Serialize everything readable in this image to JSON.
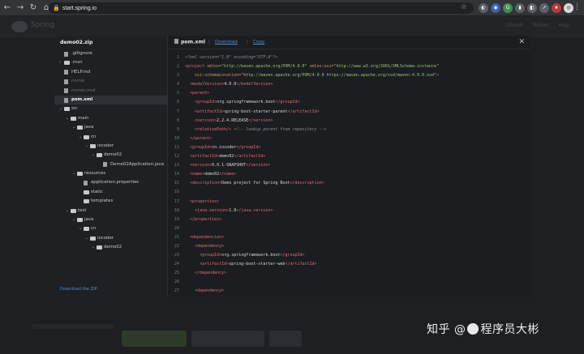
{
  "browser": {
    "url": "start.spring.io",
    "nav": {
      "back": "←",
      "forward": "→",
      "reload": "↻",
      "home": "⌂"
    },
    "lock": "🔒",
    "star": "☆",
    "extensions": [
      "◐",
      "◉",
      "G",
      "▮",
      "◧",
      "↗",
      "★",
      "◎"
    ],
    "menu": "⋮"
  },
  "background_page": {
    "title": "Spring",
    "header_links": [
      "GitHub",
      "Twitter",
      "Help"
    ]
  },
  "modal": {
    "archive_name": "demo02.zip",
    "download_zip_label": "Download the ZIP",
    "close_label": "✕",
    "tree": [
      {
        "label": ".gitignore",
        "depth": 0,
        "type": "file",
        "dim": false
      },
      {
        "label": ".mvn",
        "depth": 0,
        "type": "folder",
        "expand": "›",
        "dim": false
      },
      {
        "label": "HELP.md",
        "depth": 0,
        "type": "file",
        "dim": false
      },
      {
        "label": "mvnw",
        "depth": 0,
        "type": "file",
        "dim": true
      },
      {
        "label": "mvnw.cmd",
        "depth": 0,
        "type": "file",
        "dim": true
      },
      {
        "label": "pom.xml",
        "depth": 0,
        "type": "file",
        "selected": true
      },
      {
        "label": "src",
        "depth": 0,
        "type": "folder",
        "expand": "⌄"
      },
      {
        "label": "main",
        "depth": 1,
        "type": "folder",
        "expand": "⌄"
      },
      {
        "label": "java",
        "depth": 2,
        "type": "folder",
        "expand": "⌄"
      },
      {
        "label": "cn",
        "depth": 3,
        "type": "folder",
        "expand": "⌄"
      },
      {
        "label": "iocoder",
        "depth": 4,
        "type": "folder",
        "expand": "⌄"
      },
      {
        "label": "demo02",
        "depth": 5,
        "type": "folder",
        "expand": "⌄"
      },
      {
        "label": "Demo02Application.java",
        "depth": 6,
        "type": "file"
      },
      {
        "label": "resources",
        "depth": 2,
        "type": "folder",
        "expand": "⌄"
      },
      {
        "label": "application.properties",
        "depth": 3,
        "type": "file"
      },
      {
        "label": "static",
        "depth": 3,
        "type": "folder"
      },
      {
        "label": "templates",
        "depth": 3,
        "type": "folder"
      },
      {
        "label": "test",
        "depth": 1,
        "type": "folder",
        "expand": "⌄"
      },
      {
        "label": "java",
        "depth": 2,
        "type": "folder",
        "expand": "⌄"
      },
      {
        "label": "cn",
        "depth": 3,
        "type": "folder",
        "expand": "⌄"
      },
      {
        "label": "iocoder",
        "depth": 4,
        "type": "folder",
        "expand": "⌄"
      },
      {
        "label": "demo02",
        "depth": 5,
        "type": "folder",
        "expand": "⌄"
      }
    ],
    "code_tabs": {
      "file_name": "pom.xml",
      "separator": "|",
      "download_label": "Download",
      "copy_label": "Copy"
    },
    "code_lines": [
      [
        [
          "pi",
          "<?xml version=\"1.0\" encoding=\"UTF-8\"?>"
        ]
      ],
      [
        [
          "tag",
          "<project "
        ],
        [
          "attr",
          "xmlns="
        ],
        [
          "str",
          "\"http://maven.apache.org/POM/4.0.0\""
        ],
        [
          "attr",
          " xmlns:xsi="
        ],
        [
          "str",
          "\"http://www.w3.org/2001/XMLSchema-instance\""
        ]
      ],
      [
        [
          "txt",
          "    "
        ],
        [
          "attr",
          "xsi:schemaLocation="
        ],
        [
          "str",
          "\"http://maven.apache.org/POM/4.0.0 https://maven.apache.org/xsd/maven-4.0.0.xsd\""
        ],
        [
          "tag",
          ">"
        ]
      ],
      [
        [
          "txt",
          "  "
        ],
        [
          "tag",
          "<modelVersion>"
        ],
        [
          "txt",
          "4.0.0"
        ],
        [
          "tag",
          "</modelVersion>"
        ]
      ],
      [
        [
          "txt",
          "  "
        ],
        [
          "tag",
          "<parent>"
        ]
      ],
      [
        [
          "txt",
          "    "
        ],
        [
          "tag",
          "<groupId>"
        ],
        [
          "txt",
          "org.springframework.boot"
        ],
        [
          "tag",
          "</groupId>"
        ]
      ],
      [
        [
          "txt",
          "    "
        ],
        [
          "tag",
          "<artifactId>"
        ],
        [
          "txt",
          "spring-boot-starter-parent"
        ],
        [
          "tag",
          "</artifactId>"
        ]
      ],
      [
        [
          "txt",
          "    "
        ],
        [
          "tag",
          "<version>"
        ],
        [
          "txt",
          "2.2.4.RELEASE"
        ],
        [
          "tag",
          "</version>"
        ]
      ],
      [
        [
          "txt",
          "    "
        ],
        [
          "tag",
          "<relativePath/>"
        ],
        [
          "com",
          " <!-- lookup parent from repository -->"
        ]
      ],
      [
        [
          "txt",
          "  "
        ],
        [
          "tag",
          "</parent>"
        ]
      ],
      [
        [
          "txt",
          "  "
        ],
        [
          "tag",
          "<groupId>"
        ],
        [
          "txt",
          "cn.iocoder"
        ],
        [
          "tag",
          "</groupId>"
        ]
      ],
      [
        [
          "txt",
          "  "
        ],
        [
          "tag",
          "<artifactId>"
        ],
        [
          "txt",
          "demo02"
        ],
        [
          "tag",
          "</artifactId>"
        ]
      ],
      [
        [
          "txt",
          "  "
        ],
        [
          "tag",
          "<version>"
        ],
        [
          "txt",
          "0.0.1-SNAPSHOT"
        ],
        [
          "tag",
          "</version>"
        ]
      ],
      [
        [
          "txt",
          "  "
        ],
        [
          "tag",
          "<name>"
        ],
        [
          "txt",
          "demo02"
        ],
        [
          "tag",
          "</name>"
        ]
      ],
      [
        [
          "txt",
          "  "
        ],
        [
          "tag",
          "<description>"
        ],
        [
          "txt",
          "Demo project for Spring Boot"
        ],
        [
          "tag",
          "</description>"
        ]
      ],
      [],
      [
        [
          "txt",
          "  "
        ],
        [
          "tag",
          "<properties>"
        ]
      ],
      [
        [
          "txt",
          "    "
        ],
        [
          "tag",
          "<java.version>"
        ],
        [
          "txt",
          "1.8"
        ],
        [
          "tag",
          "</java.version>"
        ]
      ],
      [
        [
          "txt",
          "  "
        ],
        [
          "tag",
          "</properties>"
        ]
      ],
      [],
      [
        [
          "txt",
          "  "
        ],
        [
          "tag",
          "<dependencies>"
        ]
      ],
      [
        [
          "txt",
          "    "
        ],
        [
          "tag",
          "<dependency>"
        ]
      ],
      [
        [
          "txt",
          "      "
        ],
        [
          "tag",
          "<groupId>"
        ],
        [
          "txt",
          "org.springframework.boot"
        ],
        [
          "tag",
          "</groupId>"
        ]
      ],
      [
        [
          "txt",
          "      "
        ],
        [
          "tag",
          "<artifactId>"
        ],
        [
          "txt",
          "spring-boot-starter-web"
        ],
        [
          "tag",
          "</artifactId>"
        ]
      ],
      [
        [
          "txt",
          "    "
        ],
        [
          "tag",
          "</dependency>"
        ]
      ],
      [],
      [
        [
          "txt",
          "    "
        ],
        [
          "tag",
          "<dependency>"
        ]
      ]
    ]
  },
  "watermark": {
    "left": "知乎",
    "at": "@",
    "right": "程序员大彬"
  },
  "colors": {
    "link": "#4d8fd4",
    "tag": "#e06c75",
    "attr": "#d19a66",
    "string": "#98c379"
  }
}
